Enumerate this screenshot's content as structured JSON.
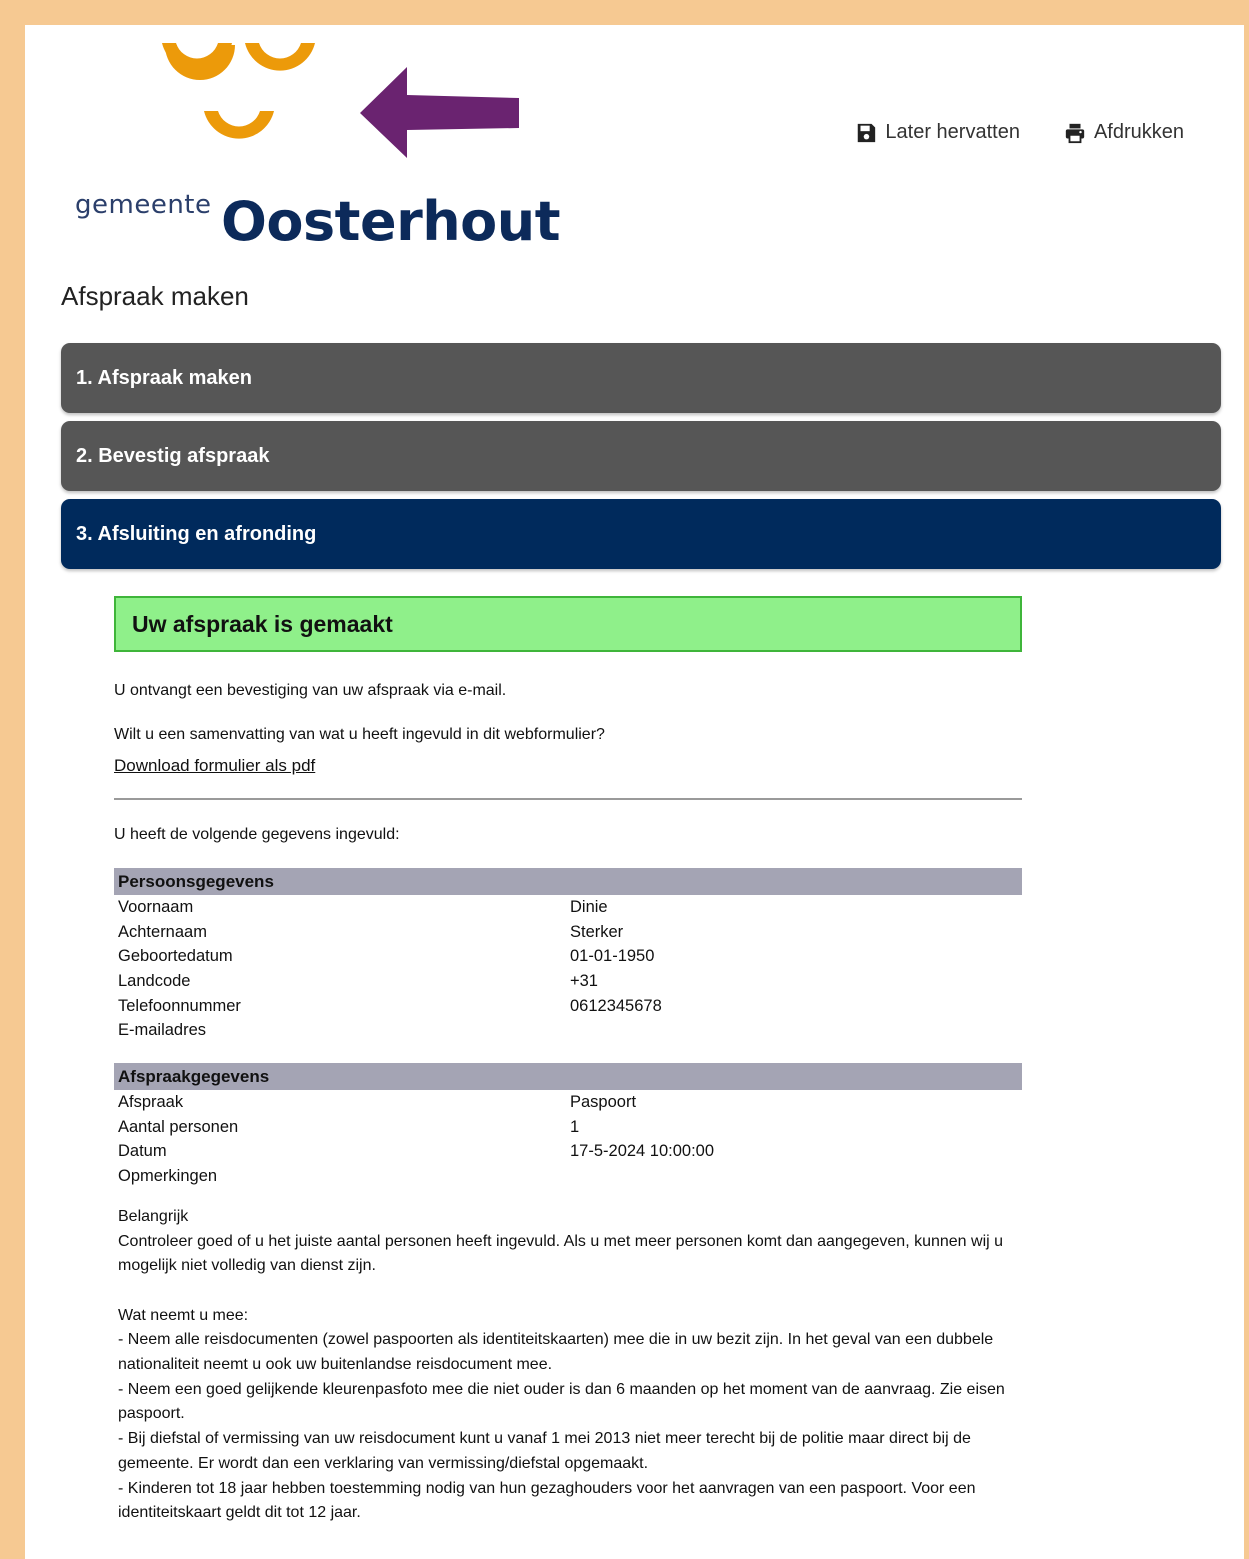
{
  "logo": {
    "word_small": "gemeente",
    "word_large": "Oosterhout",
    "brand_orange": "#ec9a0a",
    "brand_navy": "#0c2a5a",
    "arrow_color": "#6a2370"
  },
  "header": {
    "resume_label": "Later hervatten",
    "print_label": "Afdrukken",
    "resume_icon": "save-icon",
    "print_icon": "printer-icon"
  },
  "page_title": "Afspraak maken",
  "steps": [
    {
      "label": "1. Afspraak maken",
      "active": false
    },
    {
      "label": "2. Bevestig afspraak",
      "active": false
    },
    {
      "label": "3. Afsluiting en afronding",
      "active": true
    }
  ],
  "confirmation": {
    "title": "Uw afspraak is gemaakt",
    "email_note": "U ontvangt een bevestiging van uw afspraak via e-mail.",
    "summary_question": "Wilt u een samenvatting van wat u heeft ingevuld in dit webformulier?",
    "download_link": "Download formulier als pdf",
    "filled_intro": "U heeft de volgende gegevens ingevuld:"
  },
  "personal": {
    "heading": "Persoonsgegevens",
    "rows": [
      {
        "label": "Voornaam",
        "value": "Dinie"
      },
      {
        "label": "Achternaam",
        "value": "Sterker"
      },
      {
        "label": "Geboortedatum",
        "value": "01-01-1950"
      },
      {
        "label": "Landcode",
        "value": "+31"
      },
      {
        "label": "Telefoonnummer",
        "value": "0612345678"
      },
      {
        "label": "E-mailadres",
        "value": ""
      }
    ]
  },
  "appointment": {
    "heading": "Afspraakgegevens",
    "rows": [
      {
        "label": "Afspraak",
        "value": "Paspoort"
      },
      {
        "label": "Aantal personen",
        "value": "1"
      },
      {
        "label": "Datum",
        "value": "17-5-2024 10:00:00"
      },
      {
        "label": "Opmerkingen",
        "value": ""
      }
    ]
  },
  "notes": {
    "important_title": "Belangrijk",
    "important_text": "Controleer goed of u het juiste aantal personen heeft ingevuld. Als u met meer personen komt dan aangegeven, kunnen wij u mogelijk niet volledig van dienst zijn.",
    "bring_title": "Wat neemt u mee:",
    "bring_items": [
      "- Neem alle reisdocumenten (zowel paspoorten als identiteitskaarten) mee die in uw bezit zijn. In het geval van een dubbele nationaliteit neemt u ook uw buitenlandse reisdocument mee.",
      "- Neem een goed gelijkende kleurenpasfoto mee die niet ouder is dan 6 maanden op het moment van de aanvraag. Zie eisen paspoort.",
      "- Bij diefstal of vermissing van uw reisdocument kunt u vanaf 1 mei 2013 niet meer terecht bij de politie maar direct bij de gemeente. Er wordt dan een verklaring van vermissing/diefstal opgemaakt.",
      "- Kinderen tot 18 jaar hebben toestemming nodig van hun gezaghouders voor het aanvragen van een paspoort. Voor een identiteitskaart geldt dit tot 12 jaar."
    ]
  }
}
